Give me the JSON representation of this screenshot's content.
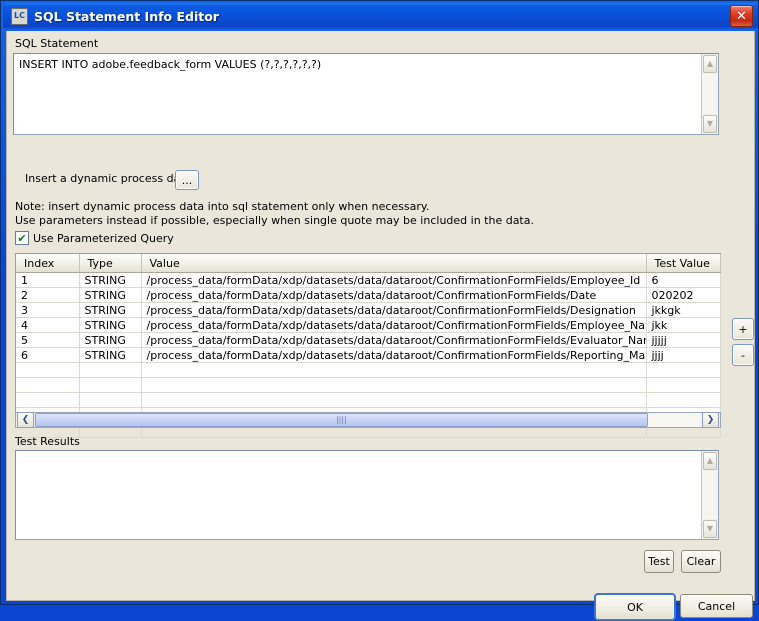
{
  "window": {
    "title": "SQL Statement Info Editor",
    "icon": "lc-app-icon",
    "icon_text": "LC",
    "close_label": "✕",
    "accent_blue": "#0A46D2",
    "dialog_bg": "#EAE7DA",
    "close_red": "#C42A12"
  },
  "sql": {
    "label": "SQL Statement",
    "value": "INSERT INTO adobe.feedback_form VALUES (?,?,?,?,?,?)",
    "scroll_up": "▲",
    "scroll_down": "▼"
  },
  "dynamic": {
    "label": "Insert a dynamic process data",
    "browse_label": "..."
  },
  "note": {
    "line1": "Note: insert dynamic process data into sql statement only when necessary.",
    "line2": "Use parameters instead if possible, especially when single quote may be included in the data."
  },
  "parameterized": {
    "label": "Use Parameterized Query",
    "checked": true,
    "check_glyph": "✔"
  },
  "table": {
    "columns": [
      "Index",
      "Type",
      "Value",
      "Test Value"
    ],
    "rows": [
      {
        "index": "1",
        "type": "STRING",
        "value": "/process_data/formData/xdp/datasets/data/dataroot/ConfirmationFormFields/Employee_Id",
        "test_value": "6"
      },
      {
        "index": "2",
        "type": "STRING",
        "value": "/process_data/formData/xdp/datasets/data/dataroot/ConfirmationFormFields/Date",
        "test_value": "020202"
      },
      {
        "index": "3",
        "type": "STRING",
        "value": "/process_data/formData/xdp/datasets/data/dataroot/ConfirmationFormFields/Designation",
        "test_value": "jkkgk"
      },
      {
        "index": "4",
        "type": "STRING",
        "value": "/process_data/formData/xdp/datasets/data/dataroot/ConfirmationFormFields/Employee_Name",
        "test_value": "jkk"
      },
      {
        "index": "5",
        "type": "STRING",
        "value": "/process_data/formData/xdp/datasets/data/dataroot/ConfirmationFormFields/Evaluator_Name",
        "test_value": "jjjjj"
      },
      {
        "index": "6",
        "type": "STRING",
        "value": "/process_data/formData/xdp/datasets/data/dataroot/ConfirmationFormFields/Reporting_Manager",
        "test_value": "jjjj"
      }
    ],
    "empty_rows": 5
  },
  "row_buttons": {
    "add_label": "+",
    "remove_label": "-"
  },
  "hscroll": {
    "left_arrow": "❮",
    "right_arrow": "❯",
    "grip": "||||"
  },
  "results": {
    "label": "Test Results",
    "value": ""
  },
  "buttons": {
    "test": "Test",
    "clear": "Clear",
    "ok": "OK",
    "cancel": "Cancel"
  }
}
